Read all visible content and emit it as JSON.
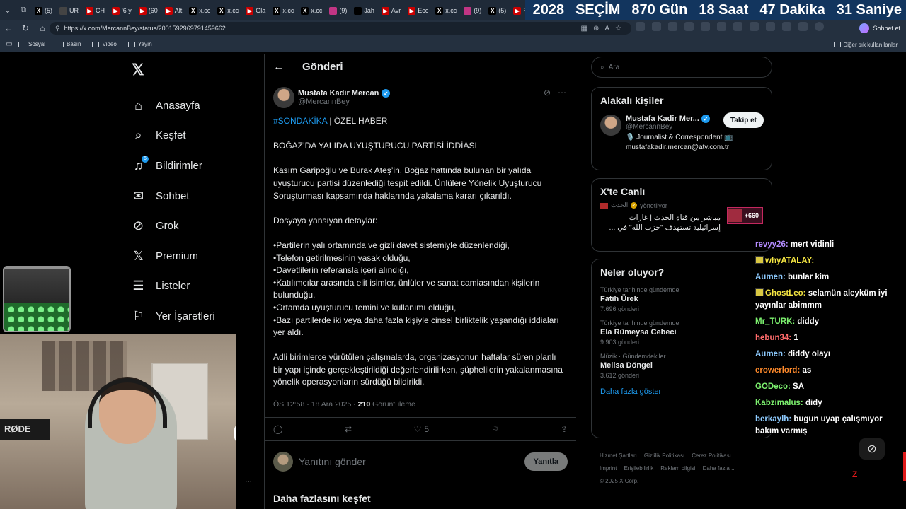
{
  "browser": {
    "tabs": [
      {
        "icon": "x-icon",
        "label": "(5)",
        "color": "#000000"
      },
      {
        "icon": "shield-icon",
        "label": "UR",
        "color": "#444444"
      },
      {
        "icon": "youtube-icon",
        "label": "CH",
        "color": "#cc0000"
      },
      {
        "icon": "youtube-icon",
        "label": "'6 y",
        "color": "#cc0000"
      },
      {
        "icon": "youtube-icon",
        "label": "(60",
        "color": "#cc0000"
      },
      {
        "icon": "youtube-icon",
        "label": "Alt",
        "color": "#cc0000"
      },
      {
        "icon": "x-icon",
        "label": "x.cc",
        "color": "#000000"
      },
      {
        "icon": "x-icon",
        "label": "x.cc",
        "color": "#000000"
      },
      {
        "icon": "youtube-icon",
        "label": "Gla",
        "color": "#cc0000"
      },
      {
        "icon": "x-icon",
        "label": "x.cc",
        "color": "#000000"
      },
      {
        "icon": "x-icon",
        "label": "x.cc",
        "color": "#000000"
      },
      {
        "icon": "instagram-icon",
        "label": "(9)",
        "color": "#c13584"
      },
      {
        "icon": "tiktok-icon",
        "label": "Jah",
        "color": "#000000"
      },
      {
        "icon": "youtube-icon",
        "label": "Avr",
        "color": "#cc0000"
      },
      {
        "icon": "youtube-icon",
        "label": "Ecc",
        "color": "#cc0000"
      },
      {
        "icon": "x-icon",
        "label": "x.cc",
        "color": "#000000"
      },
      {
        "icon": "instagram-icon",
        "label": "(9)",
        "color": "#c13584"
      },
      {
        "icon": "x-icon",
        "label": "(5)",
        "color": "#000000"
      },
      {
        "icon": "youtube-icon",
        "label": "Rec",
        "color": "#cc0000"
      }
    ],
    "countdown": [
      "2028",
      "SEÇİM",
      "870 Gün",
      "18 Saat",
      "47 Dakika",
      "31 Saniye"
    ],
    "url": "https://x.com/MercannBey/status/2001592969791459662",
    "chat_button": "Sohbet et",
    "bookmarks": [
      "Sosyal",
      "Basın",
      "Video",
      "Yayın"
    ],
    "bookmarks_right": "Diğer sık kullanılanlar"
  },
  "nav": {
    "items": [
      {
        "label": "Anasayfa",
        "icon": "home-icon",
        "glyph": "⌂"
      },
      {
        "label": "Keşfet",
        "icon": "search-icon",
        "glyph": "⌕"
      },
      {
        "label": "Bildirimler",
        "icon": "bell-icon",
        "glyph": "♫",
        "badge": "6"
      },
      {
        "label": "Sohbet",
        "icon": "mail-icon",
        "glyph": "✉"
      },
      {
        "label": "Grok",
        "icon": "grok-icon",
        "glyph": "⊘"
      },
      {
        "label": "Premium",
        "icon": "x-icon",
        "glyph": "𝕏"
      },
      {
        "label": "Listeler",
        "icon": "list-icon",
        "glyph": "☰"
      },
      {
        "label": "Yer İşaretleri",
        "icon": "bookmark-icon",
        "glyph": "⚐"
      }
    ]
  },
  "main": {
    "title": "Gönderi",
    "author": {
      "name": "Mustafa Kadir Mercan",
      "handle": "@MercannBey"
    },
    "hashtag": "#SONDAKİKA",
    "headline_rest": " | ÖZEL HABER",
    "paragraphs": [
      "BOĞAZ’DA YALIDA UYUŞTURUCU PARTİSİ İDDİASI",
      "Kasım Garipoğlu ve Burak Ateş’in, Boğaz hattında bulunan bir yalıda uyuşturucu partisi düzenlediği tespit edildi. Ünlülere Yönelik Uyuşturucu Soruşturması kapsamında haklarında yakalama kararı çıkarıldı.",
      "Dosyaya yansıyan detaylar:",
      "•Partilerin yalı ortamında ve gizli davet sistemiyle düzenlendiği,\n•Telefon getirilmesinin yasak olduğu,\n•Davetlilerin referansla içeri alındığı,\n•Katılımcılar arasında elit isimler, ünlüler ve sanat camiasından kişilerin bulunduğu,\n•Ortamda uyuşturucu temini ve kullanımı olduğu,\n•Bazı partilerde iki veya daha fazla kişiyle cinsel birliktelik yaşandığı iddiaları yer aldı.",
      "Adli birimlerce yürütülen çalışmalarda, organizasyonun haftalar süren planlı bir yapı içinde gerçekleştirildiği değerlendirilirken, şüphelilerin yakalanmasına yönelik operasyonların sürdüğü bildirildi."
    ],
    "time": "ÖS 12:58 · 18 Ara 2025 · ",
    "views": "210",
    "views_label": " Görüntüleme",
    "likes": "5",
    "reply_placeholder": "Yanıtını gönder",
    "reply_button": "Yanıtla",
    "explore_more": "Daha fazlasını keşfet"
  },
  "right": {
    "search_placeholder": "Ara",
    "related_title": "Alakalı kişiler",
    "related": {
      "name": "Mustafa Kadir Mer...",
      "handle": "@MercannBey",
      "bio": "🎙️ Journalist & Correspondent 📺 mustafakadir.mercan@atv.com.tr",
      "follow": "Takip et"
    },
    "live_title": "X'te Canlı",
    "live": {
      "host": "الحدث",
      "host_status": "yönetliyor",
      "title": "مباشر من قناة الحدث | غارات إسرائيلية تستهدف \"حزب الله\" في ...",
      "count": "+660"
    },
    "trends_title": "Neler oluyor?",
    "trends": [
      {
        "context": "Türkiye tarihinde gündemde",
        "name": "Fatih Ürek",
        "count": "7.696 gönderi"
      },
      {
        "context": "Türkiye tarihinde gündemde",
        "name": "Ela Rümeysa Cebeci",
        "count": "9.903 gönderi"
      },
      {
        "context": "Müzik · Gündemdekiler",
        "name": "Melisa Döngel",
        "count": "3.612 gönderi"
      }
    ],
    "show_more": "Daha fazla göster",
    "footer": [
      "Hizmet Şartları",
      "Gizlilik Politikası",
      "Çerez Politikası",
      "Imprint",
      "Erişilebilirlik",
      "Reklam bilgisi",
      "Daha fazla ...",
      "© 2025 X Corp."
    ]
  },
  "stream": {
    "webcam_text": "RØDE",
    "chat": [
      {
        "user": "revyy26",
        "text": "mert vidinli",
        "color": "#b48cff"
      },
      {
        "user": "whyATALAY",
        "text": "",
        "color": "#f5e642",
        "emote": true
      },
      {
        "user": "Aumen",
        "text": "bunlar kim",
        "color": "#8ecbff"
      },
      {
        "user": "GhostLeo",
        "text": "selamün aleyküm iyi yayınlar abimmm",
        "color": "#f5e642",
        "emote": true
      },
      {
        "user": "Mr_TURK",
        "text": "diddy",
        "color": "#7cf06e"
      },
      {
        "user": "hebun34",
        "text": "1",
        "color": "#ff6b6b"
      },
      {
        "user": "Aumen",
        "text": "diddy olayı",
        "color": "#8ecbff"
      },
      {
        "user": "erowerlord",
        "text": "as",
        "color": "#ff8a2b"
      },
      {
        "user": "GODeco",
        "text": "SA",
        "color": "#7cf06e"
      },
      {
        "user": "Kabzimalus",
        "text": "didy",
        "color": "#7cf06e"
      },
      {
        "user": "berkaylh",
        "text": "bugun uyap çalışmıyor bakım varmış",
        "color": "#8ecbff"
      }
    ]
  },
  "colors": {
    "accent": "#1d9bf0",
    "background": "#000000",
    "muted": "#71767b"
  }
}
